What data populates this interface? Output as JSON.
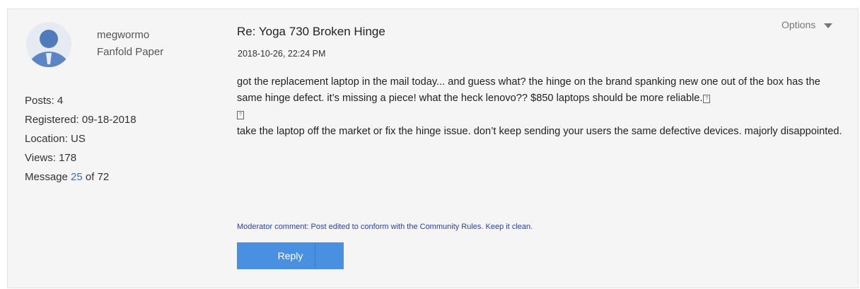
{
  "author": {
    "username": "megwormo",
    "rank": "Fanfold Paper",
    "stats": {
      "posts": "Posts: 4",
      "registered": "Registered: 09-18-2018",
      "location": "Location: US",
      "views": "Views: 178",
      "message_prefix": "Message",
      "message_number": "25",
      "message_suffix": "of 72"
    }
  },
  "post": {
    "subject": "Re: Yoga 730 Broken Hinge",
    "date": "2018-10-26, 22:24 PM",
    "options_label": "Options",
    "body": {
      "paragraph1": "got the replacement laptop in the mail today... and guess what? the hinge on the brand spanking new one out of the box has the same hinge defect. it’s missing a piece! what the heck lenovo?? $850 laptops should be more reliable.",
      "placeholder_glyph": "?",
      "paragraph2": "take the laptop off the market or fix the hinge issue. don’t keep sending your users the same defective devices. majorly disappointed."
    },
    "moderator": {
      "prefix": "Moderator comment: Post edited to conform with the ",
      "link": "Community Rules",
      "suffix": ". Keep it clean."
    },
    "reply_label": "Reply"
  },
  "colors": {
    "card_bg": "#f5f5f5",
    "link": "#3f6fb5",
    "button": "#4a90e2",
    "moderator": "#2a3fb0"
  },
  "icons": {
    "avatar": "default-user-avatar-icon",
    "options": "chevron-down-icon"
  }
}
